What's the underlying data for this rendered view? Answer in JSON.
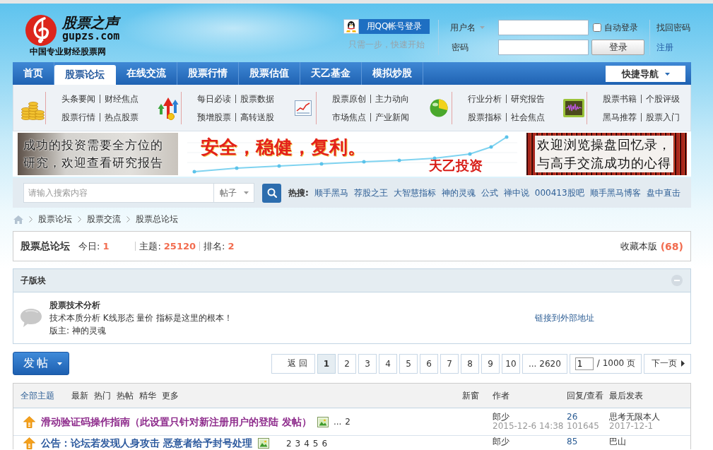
{
  "header": {
    "logo": {
      "name": "股票之声",
      "domain": "gupzs.com",
      "slogan": "中国专业财经股票网"
    },
    "qq_login": {
      "label": "用QQ帐号登录",
      "hint": "只需一步，快速开始"
    },
    "login": {
      "username_label": "用户名",
      "password_label": "密码",
      "auto_login": {
        "label": "自动登录",
        "checked": false
      },
      "submit": "登录",
      "forgot_password": "找回密码",
      "register": "注册"
    }
  },
  "nav": {
    "items": [
      {
        "label": "首页",
        "selected": false
      },
      {
        "label": "股票论坛",
        "selected": true
      },
      {
        "label": "在线交流",
        "selected": false
      },
      {
        "label": "股票行情",
        "selected": false
      },
      {
        "label": "股票估值",
        "selected": false
      },
      {
        "label": "天乙基金",
        "selected": false
      },
      {
        "label": "模拟炒股",
        "selected": false
      }
    ],
    "quick_nav": "快捷导航"
  },
  "subnav": [
    {
      "rows": [
        [
          "头条要闻",
          "财经焦点"
        ],
        [
          "股票行情",
          "热点股票"
        ]
      ]
    },
    {
      "rows": [
        [
          "每日必读",
          "股票数据"
        ],
        [
          "预增股票",
          "高转送股"
        ]
      ]
    },
    {
      "rows": [
        [
          "股票原创",
          "主力动向"
        ],
        [
          "市场焦点",
          "产业新闻"
        ]
      ]
    },
    {
      "rows": [
        [
          "行业分析",
          "研究报告"
        ],
        [
          "股票指标",
          "社会焦点"
        ]
      ]
    },
    {
      "rows": [
        [
          "股票书籍",
          "个股评级"
        ],
        [
          "黑马推荐",
          "股票入门"
        ]
      ]
    }
  ],
  "banners": [
    {
      "kind": "photo",
      "lines": [
        "成功的投资需要全方位的",
        "研究，欢迎查看研究报告"
      ]
    },
    {
      "kind": "chart",
      "lines": [
        "安全，稳健，复利。"
      ],
      "brand": "天乙投资"
    },
    {
      "kind": "board",
      "lines": [
        "欢迎浏览操盘回忆录，",
        "与高手交流成功的心得"
      ]
    }
  ],
  "search": {
    "placeholder": "请输入搜索内容",
    "scope": "帖子",
    "hot_label": "热搜:",
    "hot": [
      "顺手黑马",
      "荐股之王",
      "大智慧指标",
      "神的灵魂",
      "公式",
      "禅中说",
      "000413股吧",
      "顺手黑马博客",
      "盘中直击"
    ]
  },
  "breadcrumb": [
    "股票论坛",
    "股票交流",
    "股票总论坛"
  ],
  "forum": {
    "title": "股票总论坛",
    "stats": [
      {
        "label": "今日:",
        "value": "1"
      },
      {
        "label": "主题:",
        "value": "25120"
      },
      {
        "label": "排名:",
        "value": "2"
      }
    ],
    "favorite": {
      "label": "收藏本版",
      "count": "(68)"
    }
  },
  "subforums": {
    "title": "子版块",
    "expanded": true,
    "items": [
      {
        "name": "股票技术分析",
        "description": "技术本质分析 K线形态 量价 指标是这里的根本！",
        "moderator_label": "版主:",
        "moderator": "神的灵魂",
        "link": "链接到外部地址"
      }
    ]
  },
  "post_button": "发帖",
  "pager": {
    "back": "返 回",
    "pages": [
      {
        "label": "1",
        "selected": true
      },
      {
        "label": "2",
        "selected": false
      },
      {
        "label": "3",
        "selected": false
      },
      {
        "label": "4",
        "selected": false
      },
      {
        "label": "5",
        "selected": false
      },
      {
        "label": "6",
        "selected": false
      },
      {
        "label": "7",
        "selected": false
      },
      {
        "label": "8",
        "selected": false
      },
      {
        "label": "9",
        "selected": false
      },
      {
        "label": "10",
        "selected": false
      }
    ],
    "last": "... 2620",
    "page_input": "1",
    "total": "/ 1000 页",
    "next": "下一页"
  },
  "threads": {
    "all": "全部主题",
    "filters": [
      "最新",
      "热门",
      "热帖",
      "精华",
      "更多"
    ],
    "new_window": "新窗",
    "columns": [
      "作者",
      "回复/查看",
      "最后发表"
    ],
    "rows": [
      {
        "title": "滑动验证码操作指南（此设置只针对新注册用户的登陆 发帖）",
        "color": "#8e2c8c",
        "has_image": true,
        "pages": {
          "prefix": "...",
          "links": [
            "2"
          ]
        },
        "author": "郎少",
        "date": "2015-12-6 14:38",
        "replies": "26",
        "views": "101645",
        "last_poster": "思考无限本人",
        "last_date": "2017-12-1"
      },
      {
        "title": "公告：论坛若发现人身攻击 恶意者给予封号处理",
        "color": "#2d5a9e",
        "has_image": true,
        "pages": {
          "links": [
            "2",
            "3",
            "4",
            "5",
            "6"
          ]
        },
        "author": "郎少",
        "replies": "85",
        "last_poster": "巴山"
      }
    ]
  }
}
